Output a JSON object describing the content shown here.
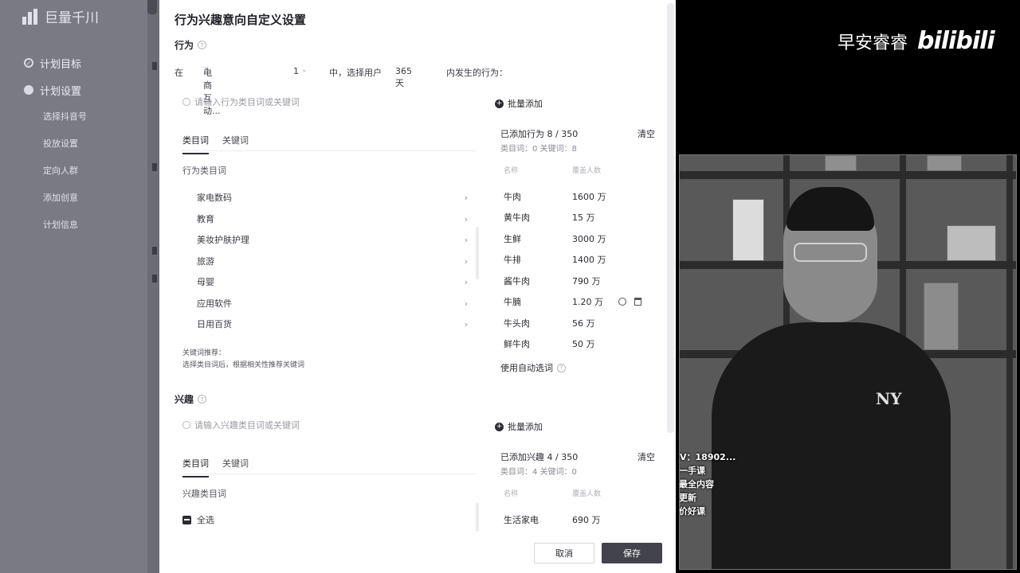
{
  "app": {
    "brand": "巨量千川",
    "nav": [
      {
        "label": "计划目标"
      },
      {
        "label": "计划设置"
      }
    ],
    "subnav": [
      "选择抖音号",
      "投放设置",
      "定向人群",
      "添加创意",
      "计划信息"
    ]
  },
  "modal": {
    "title": "行为兴趣意向自定义设置",
    "behavior": {
      "section_title": "行为",
      "filter": {
        "prefix": "在",
        "scene_value": "电商互动...",
        "count_value": "1",
        "mid": "中，选择用户",
        "days_value": "365天",
        "suffix": "内发生的行为："
      },
      "search_placeholder": "请输入行为类目词或关键词",
      "batch_add": "批量添加",
      "tabs": [
        "类目词",
        "关键词"
      ],
      "category_label": "行为类目词",
      "categories": [
        "家电数码",
        "教育",
        "美妆护肤护理",
        "旅游",
        "母婴",
        "应用软件",
        "日用百货"
      ],
      "hint_title": "关键词推荐：",
      "hint_text": "选择类目词后，根据相关性推荐关键词",
      "selected_title": "已添加行为 8 / 350",
      "selected_sub": "类目词：0   关键词：8",
      "clear": "清空",
      "col_name": "名称",
      "col_volume": "覆盖人数",
      "selected_items": [
        {
          "name": "牛肉",
          "volume": "1600 万"
        },
        {
          "name": "黄牛肉",
          "volume": "15 万"
        },
        {
          "name": "生鲜",
          "volume": "3000 万"
        },
        {
          "name": "牛排",
          "volume": "1400 万"
        },
        {
          "name": "酱牛肉",
          "volume": "790 万"
        },
        {
          "name": "牛腩",
          "volume": "1.20 万"
        },
        {
          "name": "牛头肉",
          "volume": "56 万"
        },
        {
          "name": "鲜牛肉",
          "volume": "50 万"
        }
      ],
      "auto_words": "使用自动选词"
    },
    "interest": {
      "section_title": "兴趣",
      "search_placeholder": "请输入兴趣类目词或关键词",
      "batch_add": "批量添加",
      "tabs": [
        "类目词",
        "关键词"
      ],
      "category_label": "兴趣类目词",
      "select_all": "全选",
      "selected_title": "已添加兴趣 4 / 350",
      "selected_sub": "类目词：4   关键词：0",
      "clear": "清空",
      "col_name": "名称",
      "col_volume": "覆盖人数",
      "selected_items": [
        {
          "name": "生活家电",
          "volume": "690 万"
        }
      ]
    },
    "buttons": {
      "cancel": "取消",
      "save": "保存"
    }
  },
  "video": {
    "channel_name": "早安睿睿",
    "platform_logo": "bilibili",
    "shirt_logo": "NY",
    "overlay_lines": [
      "V：18902...",
      "分享一手课",
      "最新最全内容",
      "每周更新",
      "超低价好课"
    ]
  },
  "colors": {
    "modal_bg": "#ffffff",
    "dim_bg": "#7a7a84",
    "primary_btn": "#43434d"
  }
}
